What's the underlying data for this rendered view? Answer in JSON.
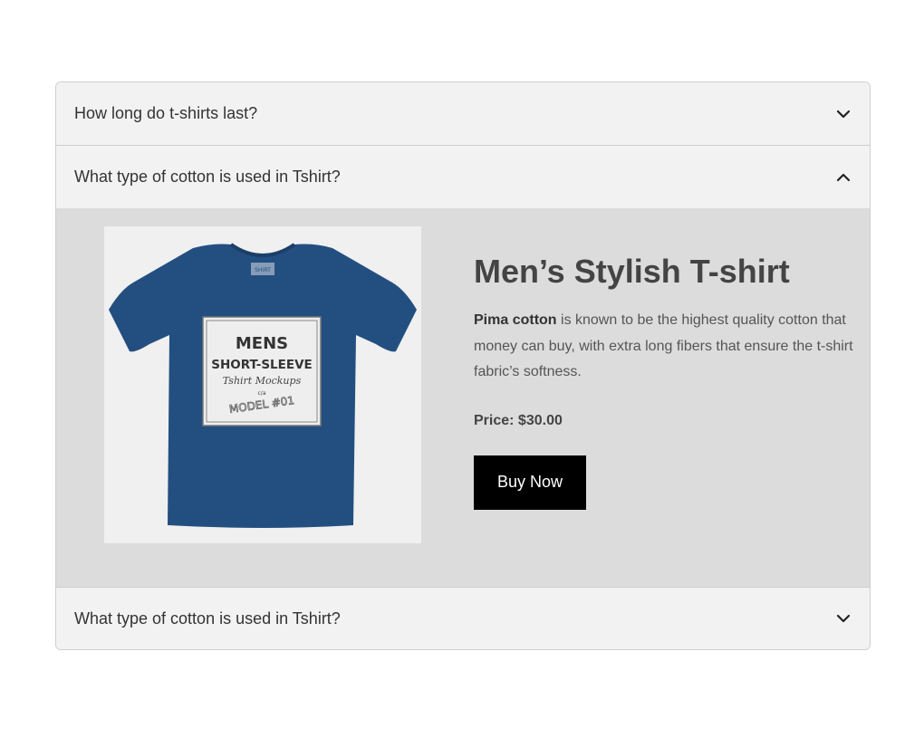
{
  "faq": {
    "items": [
      {
        "question": "How long do t-shirts last?",
        "expanded": false
      },
      {
        "question": "What type of cotton is used in Tshirt?",
        "expanded": true
      },
      {
        "question": "What type of cotton is used in Tshirt?",
        "expanded": false
      }
    ]
  },
  "product": {
    "title": "Men’s Stylish T-shirt",
    "description_bold": "Pima cotton",
    "description_rest": " is known to be the highest quality cotton that money can buy, with extra long fibers that ensure the t-shirt fabric’s softness.",
    "price_label": "Price:",
    "price_value": "$30.00",
    "buy_label": "Buy Now",
    "image": {
      "shirt_color": "#234f80",
      "mockup_lines": [
        "MENS",
        "SHORT-SLEEVE",
        "Tshirt Mockups",
        "c/a",
        "MODEL #01"
      ],
      "tag_text": "SHIRT"
    }
  },
  "colors": {
    "header_bg": "#f3f2f2",
    "body_bg": "#dcdcdc",
    "button_bg": "#000000"
  }
}
